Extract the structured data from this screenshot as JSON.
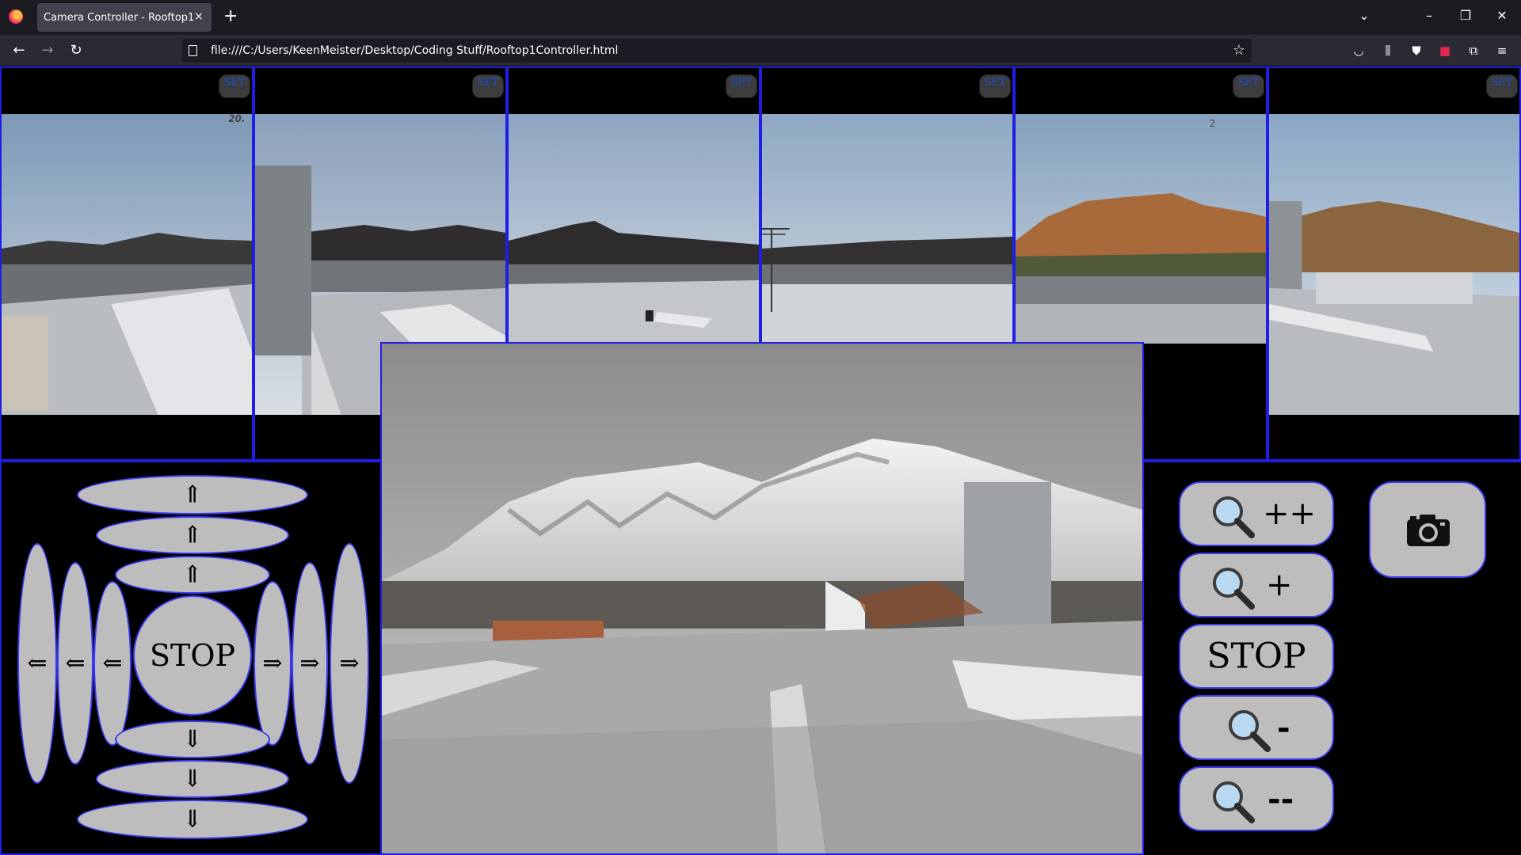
{
  "browser": {
    "tab_title": "Camera Controller - Rooftop1",
    "tab_close": "×",
    "new_tab": "+",
    "url": "file:///C:/Users/KeenMeister/Desktop/Coding Stuff/Rooftop1Controller.html",
    "nav": {
      "back": "←",
      "forward": "→",
      "reload": "↻"
    },
    "window": {
      "list_all_tabs": "⌄",
      "minimize": "–",
      "restore": "❐",
      "close": "✕"
    },
    "toolbar_icons": [
      "pocket-icon",
      "library-icon",
      "shield-icon",
      "extension-red-icon",
      "extensions-icon",
      "menu-icon"
    ]
  },
  "presets": [
    {
      "set_label": "SET",
      "scene": "overlay-20",
      "overlay_text": "20."
    },
    {
      "set_label": "SET",
      "scene": "tower-left"
    },
    {
      "set_label": "SET",
      "scene": "hills-center"
    },
    {
      "set_label": "SET",
      "scene": "antenna"
    },
    {
      "set_label": "SET",
      "scene": "sunlit-hills",
      "overlay_text": "2"
    },
    {
      "set_label": "SET",
      "scene": "roof-right"
    }
  ],
  "ptz": {
    "up_arrows": [
      "⇑",
      "⇑",
      "⇑"
    ],
    "down_arrows": [
      "⇓",
      "⇓",
      "⇓"
    ],
    "left_arrows": [
      "⇐",
      "⇐",
      "⇐"
    ],
    "right_arrows": [
      "⇒",
      "⇒",
      "⇒"
    ],
    "stop_label": "STOP"
  },
  "zoom": {
    "zoom_in_fast": "++",
    "zoom_in": "+",
    "stop_label": "STOP",
    "zoom_out": "-",
    "zoom_out_fast": "--",
    "snapshot_icon": "camera-icon"
  },
  "colors": {
    "border": "#1e1ee6",
    "button_bg": "#bdbdbd",
    "button_outline": "#3a3af0",
    "set_text": "#1a4fd6"
  }
}
